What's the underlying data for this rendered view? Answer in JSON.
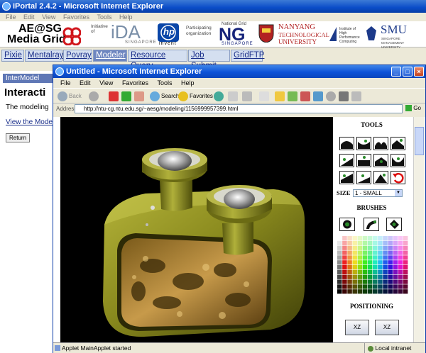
{
  "outer": {
    "title": "iPortal 2.4.2 - Microsoft Internet Explorer",
    "menu": [
      "File",
      "Edit",
      "View",
      "Favorites",
      "Tools",
      "Help"
    ]
  },
  "banner": {
    "logo_line1": "AE@SG",
    "logo_line2": "Media Grid",
    "initiative_of": "Initiative of",
    "ida": "iDA",
    "ida_sub": "SINGAPORE",
    "hp": "hp",
    "hp_sub": "invent",
    "participating": "Participating organization",
    "ng_top": "National Grid",
    "ng": "NG",
    "ng_sub": "SINGAPORE",
    "ntu1": "NANYANG",
    "ntu2": "TECHNOLOGICAL",
    "ntu3": "UNIVERSITY",
    "ihpc": "Institute of High Performance Computing",
    "smu": "SMU",
    "smu_sub": "SINGAPORE MANAGEMENT UNIVERSITY"
  },
  "nav": [
    {
      "label": "Pixie"
    },
    {
      "label": "Mentalray"
    },
    {
      "label": "Povray"
    },
    {
      "label": "Modeler"
    },
    {
      "label": "Resource Query"
    },
    {
      "label": "Job Submit"
    },
    {
      "label": "GridFTP"
    }
  ],
  "side": {
    "header": "InterModel",
    "title": "Interacti",
    "text": "The modeling",
    "link": "View the Mode",
    "return_button": "Return"
  },
  "popup": {
    "title": "Untitled - Microsoft Internet Explorer",
    "menu": [
      "File",
      "Edit",
      "View",
      "Favorites",
      "Tools",
      "Help"
    ],
    "toolbar": {
      "back": "Back",
      "search": "Search",
      "favorites": "Favorites"
    },
    "address_label": "Address",
    "address_value": "http://ntu-cg.ntu.edu.sg/~aesg/modeling/1156999957399.html",
    "go": "Go"
  },
  "tools": {
    "heading": "TOOLS",
    "size_label": "SIZE",
    "size_value": "1 - SMALL",
    "brushes_heading": "BRUSHES",
    "positioning_heading": "POSITIONING",
    "pos_buttons": [
      "XZ",
      "XZ"
    ]
  },
  "status": {
    "text": "Applet MainApplet started",
    "zone": "Local intranet"
  },
  "colors": {
    "model_olive": "#8a8a1e",
    "title_blue": "#0d52d8",
    "nav_active": "#6e86c0"
  }
}
